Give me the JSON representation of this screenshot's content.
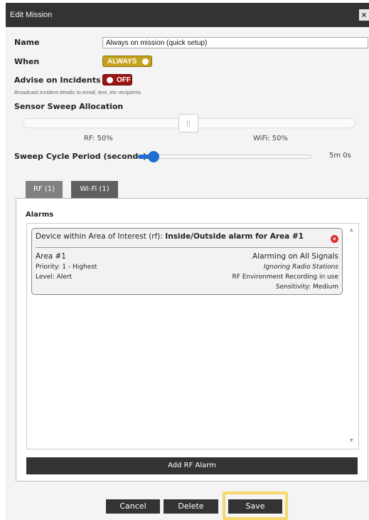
{
  "dialog": {
    "title": "Edit Mission",
    "close_glyph": "×"
  },
  "form": {
    "name_label": "Name",
    "name_value": "Always on mission (quick setup)",
    "when_label": "When",
    "when_toggle": "ALWAYS",
    "advise_label": "Advise on Incidents",
    "advise_toggle": "OFF",
    "advise_hint": "Broadcast incident details to email, text, etc recipients",
    "sweep_label": "Sensor Sweep Allocation",
    "sweep_rf_percent": 50,
    "rf_pct_label": "RF: 50%",
    "wifi_pct_label": "WiFi: 50%",
    "cycle_label": "Sweep Cycle Period (seconds)",
    "cycle_value": "5m 0s",
    "cycle_fill_fraction": 0.09
  },
  "tabs": [
    {
      "label": "RF (1)"
    },
    {
      "label": "Wi-Fi (1)"
    }
  ],
  "alarms": {
    "title": "Alarms",
    "items": [
      {
        "head_prefix": "Device within Area of Interest (rf):",
        "head_bold": "Inside/Outside alarm for Area #1",
        "area": "Area #1",
        "priority": "Priority: 1 - Highest",
        "level": "Level: Alert",
        "alarming": "Alarming on All Signals",
        "ignoring": "Ignoring Radio Stations",
        "recording": "RF Environment Recording in use",
        "sensitivity": "Sensitivity: Medium"
      }
    ],
    "add_button": "Add RF Alarm"
  },
  "footer": {
    "cancel": "Cancel",
    "delete": "Delete",
    "save": "Save"
  },
  "colors": {
    "titlebar": "#333333",
    "always_toggle": "#c5a21c",
    "off_toggle": "#9a1414",
    "slider_accent": "#1f6fd1",
    "save_highlight": "#f7d96a"
  }
}
